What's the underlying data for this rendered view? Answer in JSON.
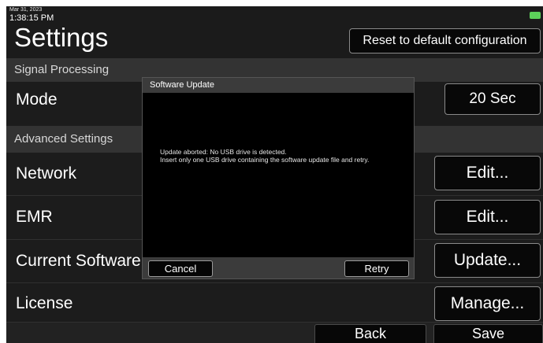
{
  "status_bar": {
    "date": "Mar 31, 2023",
    "time": "1:38:15 PM",
    "battery_color": "#5cd05a"
  },
  "header": {
    "title": "Settings",
    "reset_label": "Reset to default configuration"
  },
  "sections": {
    "signal_processing": "Signal Processing",
    "advanced_settings": "Advanced Settings"
  },
  "rows": {
    "mode": {
      "label": "Mode",
      "button": "20 Sec"
    },
    "network": {
      "label": "Network",
      "button": "Edit..."
    },
    "emr": {
      "label": "EMR",
      "button": "Edit..."
    },
    "current_software": {
      "label": "Current Software",
      "button": "Update..."
    },
    "license": {
      "label": "License",
      "button": "Manage..."
    }
  },
  "footer": {
    "back_label": "Back",
    "save_label": "Save"
  },
  "dialog": {
    "title": "Software Update",
    "message_line1": "Update aborted: No USB drive is detected.",
    "message_line2": "Insert only one USB drive containing the software update file and retry.",
    "cancel_label": "Cancel",
    "retry_label": "Retry"
  }
}
